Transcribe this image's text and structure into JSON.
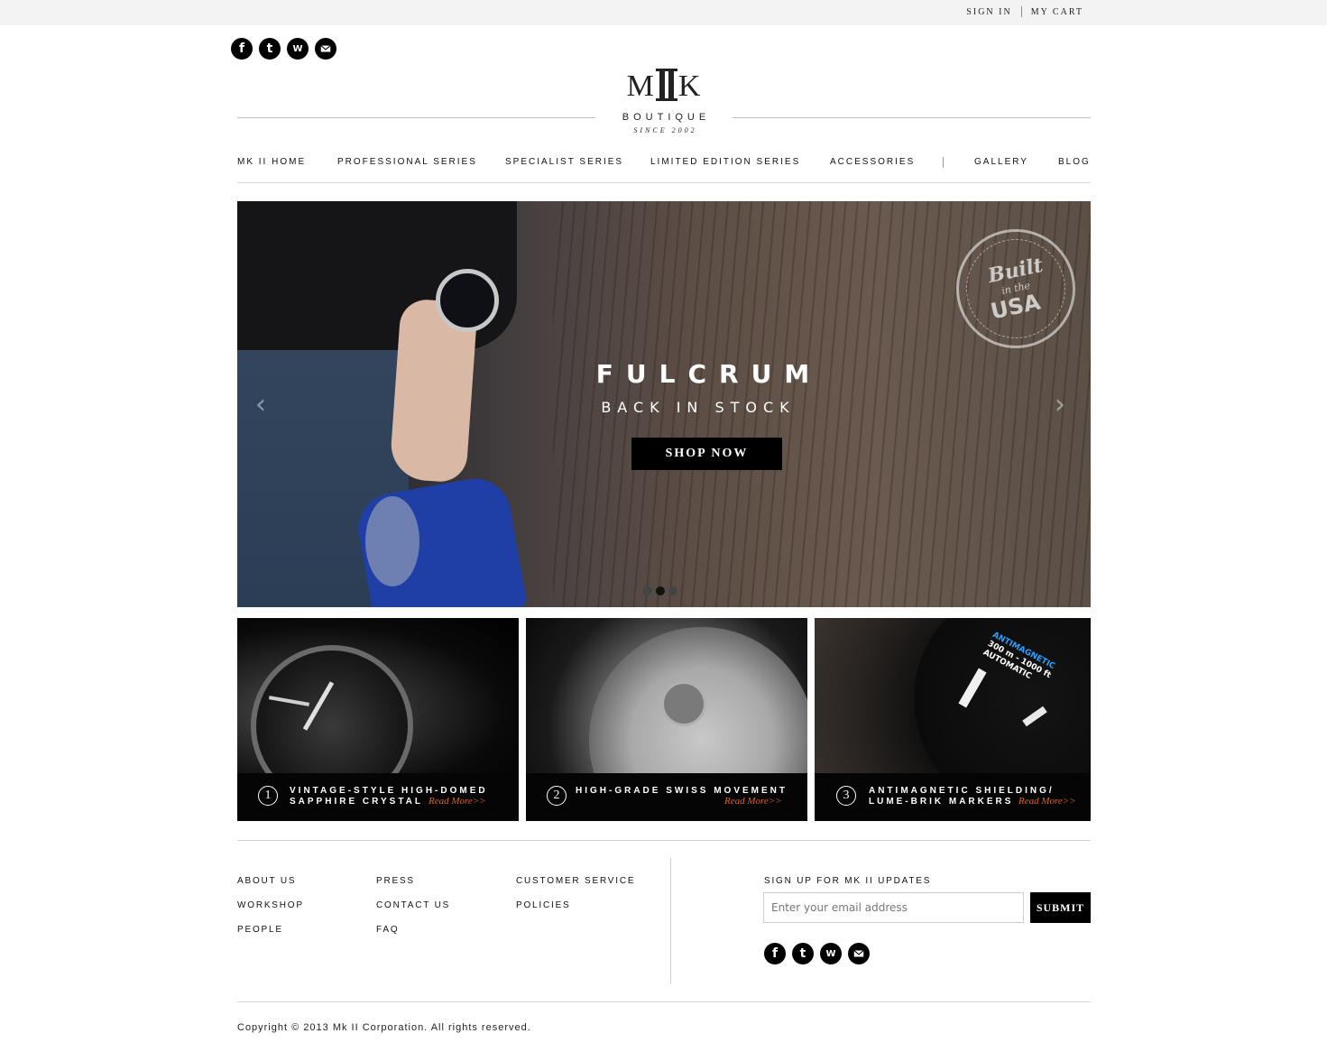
{
  "topbar": {
    "sign_in": "SIGN IN",
    "my_cart": "MY CART"
  },
  "social": {
    "facebook": "f",
    "twitter": "t",
    "wordpress": "W",
    "email": "email"
  },
  "logo": {
    "mark_left": "M",
    "mark_right": "K",
    "word": "BOUTIQUE",
    "since": "SINCE 2002"
  },
  "nav": {
    "items": [
      "MK II HOME",
      "PROFESSIONAL SERIES",
      "SPECIALIST SERIES",
      "LIMITED EDITION SERIES",
      "ACCESSORIES",
      "GALLERY",
      "BLOG"
    ]
  },
  "hero": {
    "title": "FULCRUM",
    "subtitle": "BACK IN STOCK",
    "cta": "SHOP NOW",
    "stamp": {
      "line1": "Built",
      "line2": "in the",
      "line3": "USA"
    },
    "prev": "‹",
    "next": "›",
    "slides": 3,
    "active_slide": 2
  },
  "features": [
    {
      "num": "1",
      "line1": "VINTAGE-STYLE HIGH-DOMED",
      "line2": "SAPPHIRE CRYSTAL",
      "more": "Read More>>"
    },
    {
      "num": "2",
      "line1": "HIGH-GRADE SWISS MOVEMENT",
      "line2": "",
      "more": "Read More>>"
    },
    {
      "num": "3",
      "line1": "ANTIMAGNETIC SHIELDING/",
      "line2": "LUME-BRIK MARKERS",
      "more": "Read More>>"
    }
  ],
  "feature_dial_text": {
    "line1": "ANTIMAGNETIC",
    "line2": "300 m - 1000 ft",
    "line3": "AUTOMATIC"
  },
  "footer": {
    "col1": [
      "ABOUT US",
      "WORKSHOP",
      "PEOPLE"
    ],
    "col2": [
      "PRESS",
      "CONTACT US",
      "FAQ"
    ],
    "col3": [
      "CUSTOMER SERVICE",
      "POLICIES"
    ],
    "signup_label": "SIGN UP FOR MK II UPDATES",
    "email_placeholder": "Enter your email address",
    "submit": "SUBMIT",
    "copyright": "Copyright © 2013 Mk II Corporation. All rights reserved."
  },
  "colors": {
    "accent_orange": "#d9632a",
    "topbar_bg": "#f3f3f3",
    "black": "#000000"
  }
}
